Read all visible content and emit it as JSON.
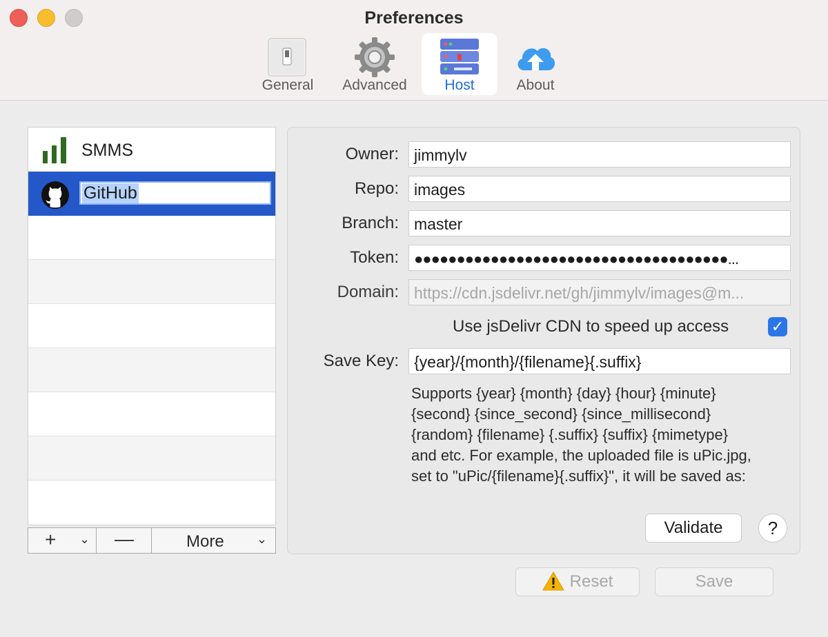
{
  "window": {
    "title": "Preferences"
  },
  "tabs": [
    {
      "label": "General",
      "icon": "switch-icon"
    },
    {
      "label": "Advanced",
      "icon": "gear-icon"
    },
    {
      "label": "Host",
      "icon": "server-icon",
      "active": true
    },
    {
      "label": "About",
      "icon": "cloud-upload-icon"
    }
  ],
  "hosts": {
    "items": [
      {
        "name": "SMMS",
        "icon": "signal-bars-icon"
      },
      {
        "name": "GitHub",
        "icon": "github-icon",
        "selected": true,
        "editing": true
      }
    ],
    "buttons": {
      "add": "+",
      "remove": "—",
      "more": "More"
    }
  },
  "settings": {
    "owner": {
      "label": "Owner:",
      "value": "jimmylv"
    },
    "repo": {
      "label": "Repo:",
      "value": "images"
    },
    "branch": {
      "label": "Branch:",
      "value": "master"
    },
    "token": {
      "label": "Token:",
      "value": "●●●●●●●●●●●●●●●●●●●●●●●●●●●●●●●●●●●●●..."
    },
    "domain": {
      "label": "Domain:",
      "value": "https://cdn.jsdelivr.net/gh/jimmylv/images@m..."
    },
    "cdn_checkbox": {
      "label": "Use jsDelivr CDN to speed up access",
      "checked": true
    },
    "save_key": {
      "label": "Save Key:",
      "value": "{year}/{month}/{filename}{.suffix}"
    },
    "help_lines": [
      "Supports {year} {month} {day} {hour} {minute}",
      "{second} {since_second} {since_millisecond}",
      "{random} {filename} {.suffix} {suffix} {mimetype}",
      "and etc. For example, the uploaded file is uPic.jpg,",
      "set to \"uPic/{filename}{.suffix}\", it will be saved as:"
    ],
    "validate_label": "Validate",
    "help_label": "?"
  },
  "footer": {
    "reset_label": "Reset",
    "save_label": "Save"
  },
  "colors": {
    "accent": "#2458c9",
    "checkbox": "#2a76e8",
    "active_tab_text": "#1f6fd8"
  }
}
